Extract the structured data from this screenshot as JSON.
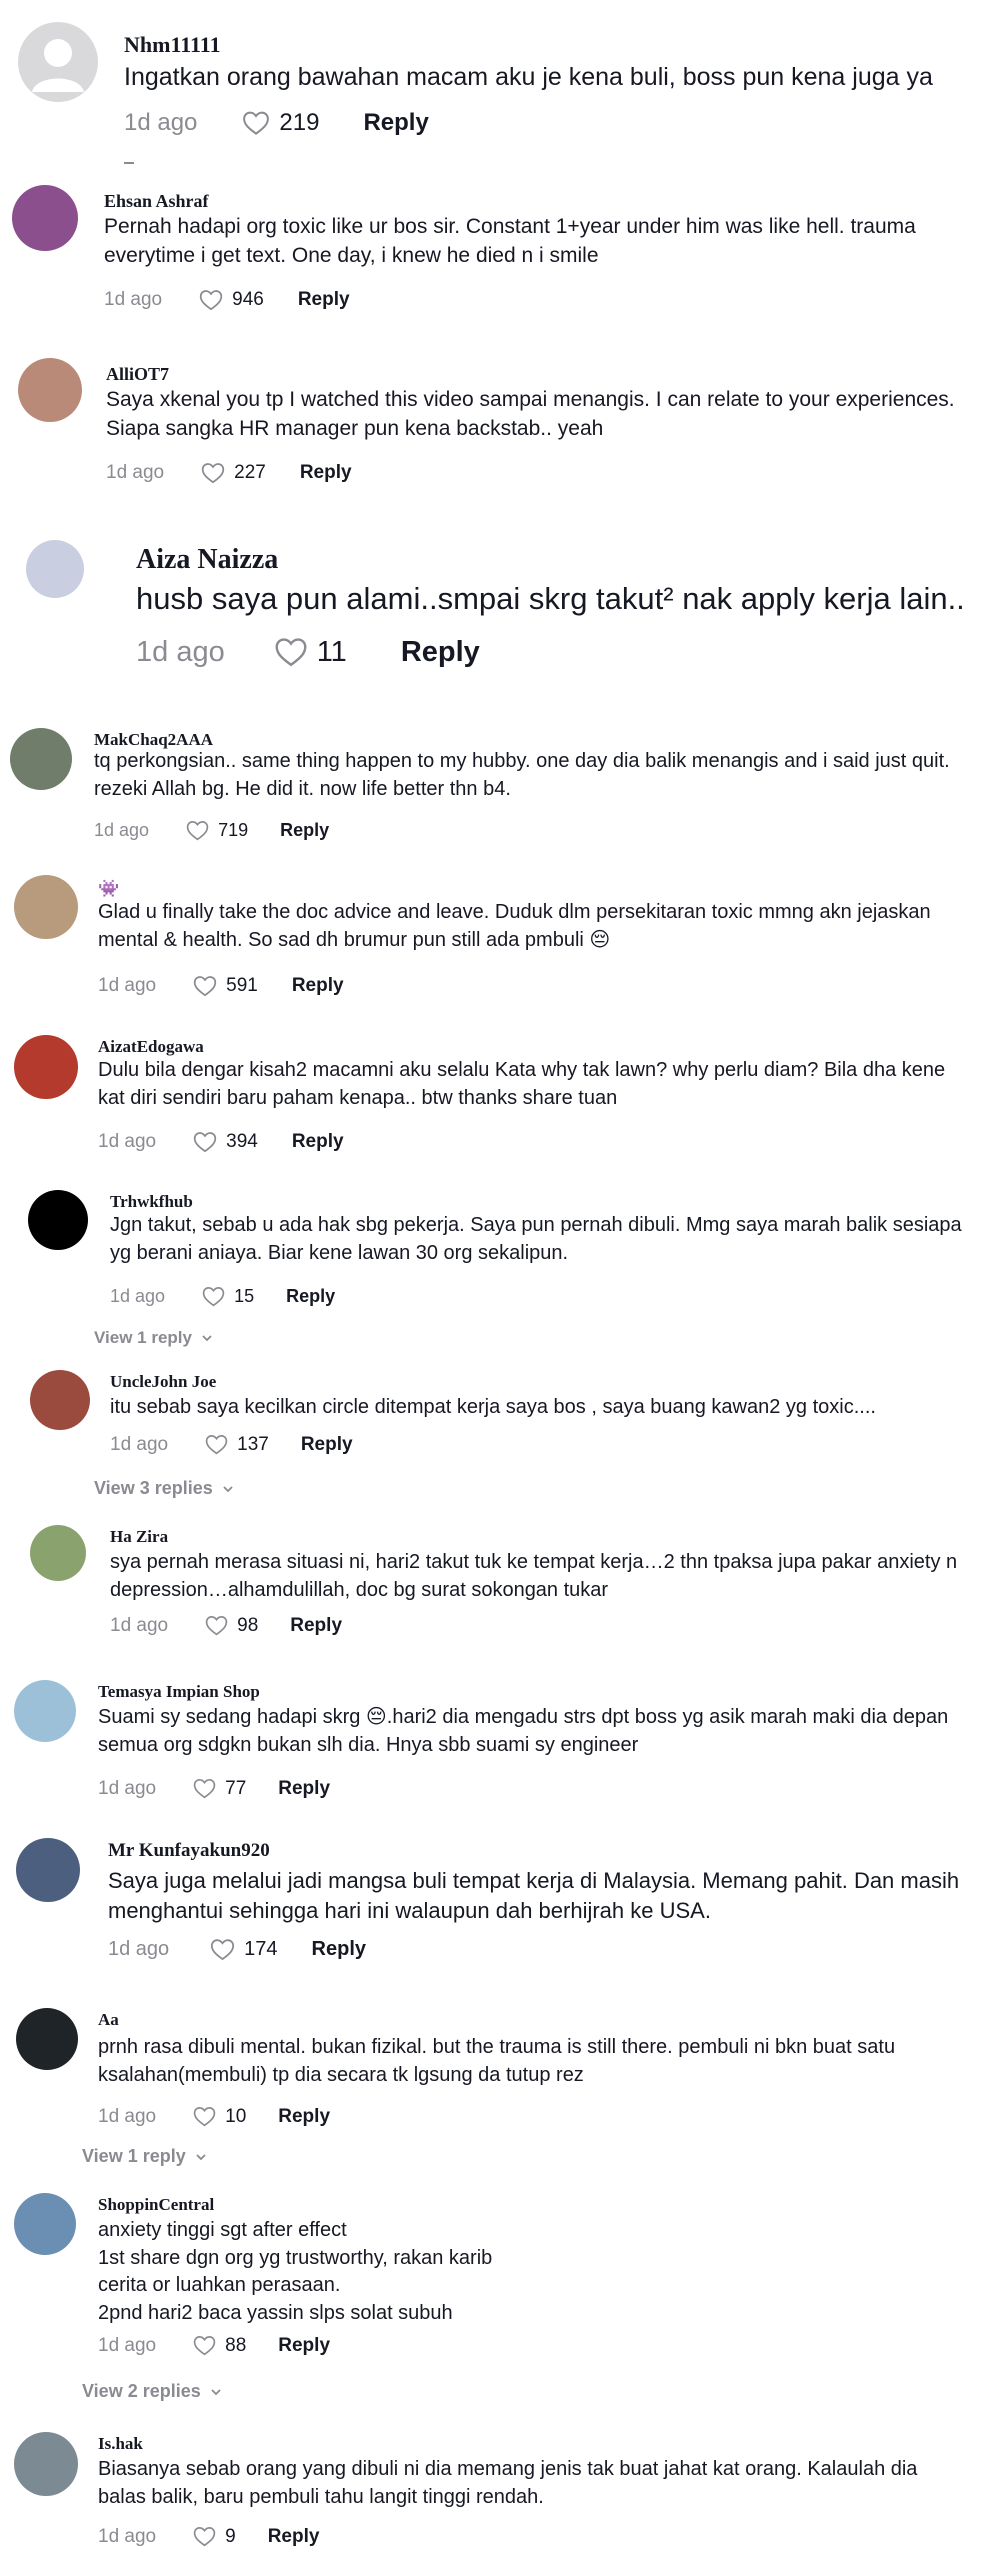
{
  "comments": [
    {
      "username": "Nhm11111",
      "text": "Ingatkan orang bawahan macam aku je kena buli, boss pun kena juga ya",
      "time": "1d ago",
      "likes": "219",
      "reply": "Reply",
      "avatar_color": "#d9d9dc"
    },
    {
      "username": "Ehsan Ashraf",
      "text": "Pernah hadapi org toxic like ur bos sir. Constant 1+year under him was like hell. trauma\neverytime i get text. One day, i knew he died n i smile",
      "time": "1d ago",
      "likes": "946",
      "reply": "Reply",
      "avatar_color": "#8a4f8c"
    },
    {
      "username": "AlliOT7",
      "text": "Saya xkenal you tp I watched this video sampai menangis. I can relate to your experiences.\nSiapa sangka HR manager pun kena backstab.. yeah",
      "time": "1d ago",
      "likes": "227",
      "reply": "Reply",
      "avatar_color": "#b98a78"
    },
    {
      "username": "Aiza Naizza",
      "text": "husb saya pun alami..smpai skrg takut² nak apply kerja lain..",
      "time": "1d ago",
      "likes": "11",
      "reply": "Reply",
      "avatar_color": "#c9cfe0"
    },
    {
      "username": "MakChaq2AAA",
      "text": "tq perkongsian.. same thing happen to my hubby. one day dia balik menangis and i said just quit.\nrezeki Allah bg. He did it. now life better thn b4.",
      "time": "1d ago",
      "likes": "719",
      "reply": "Reply",
      "avatar_color": "#6f7d6a"
    },
    {
      "username": "👾",
      "text": "Glad u finally take the doc advice and leave. Duduk dlm persekitaran toxic mmng akn jejaskan\nmental & health. So sad dh brumur pun still ada pmbuli 😔",
      "time": "1d ago",
      "likes": "591",
      "reply": "Reply",
      "avatar_color": "#b89a7d"
    },
    {
      "username": "AizatEdogawa",
      "text": "Dulu bila dengar kisah2 macamni aku selalu Kata why tak lawn? why perlu diam? Bila dha kene\nkat diri sendiri baru paham kenapa.. btw thanks share tuan",
      "time": "1d ago",
      "likes": "394",
      "reply": "Reply",
      "avatar_color": "#b33a2c"
    },
    {
      "username": "Trhwkfhub",
      "text": "Jgn takut, sebab u ada hak sbg pekerja. Saya pun pernah dibuli. Mmg saya marah balik sesiapa\nyg berani aniaya. Biar kene lawan 30 org sekalipun.",
      "time": "1d ago",
      "likes": "15",
      "reply": "Reply",
      "avatar_color": "#000000",
      "view_replies": "View 1 reply"
    },
    {
      "username": "UncleJohn Joe",
      "text": "itu sebab saya kecilkan circle ditempat kerja saya bos , saya buang kawan2 yg toxic....",
      "time": "1d ago",
      "likes": "137",
      "reply": "Reply",
      "avatar_color": "#9b4a3e",
      "view_replies": "View 3 replies"
    },
    {
      "username": "Ha Zira",
      "text": "sya pernah merasa situasi ni, hari2 takut tuk ke tempat kerja…2 thn tpaksa jupa pakar anxiety n\ndepression…alhamdulillah, doc bg surat sokongan tukar",
      "time": "1d ago",
      "likes": "98",
      "reply": "Reply",
      "avatar_color": "#8aa36e"
    },
    {
      "username": "Temasya Impian Shop",
      "text": "Suami sy sedang hadapi skrg 😔.hari2 dia mengadu strs dpt boss yg asik marah maki dia depan\nsemua org sdgkn bukan slh dia. Hnya sbb suami sy engineer",
      "time": "1d ago",
      "likes": "77",
      "reply": "Reply",
      "avatar_color": "#9cc0d8"
    },
    {
      "username": "Mr Kunfayakun920",
      "text": "Saya juga melalui jadi mangsa buli tempat kerja di Malaysia. Memang pahit. Dan masih\nmenghantui sehingga hari ini walaupun dah berhijrah ke USA.",
      "time": "1d ago",
      "likes": "174",
      "reply": "Reply",
      "avatar_color": "#4d5f7e"
    },
    {
      "username": "Aa",
      "text": "prnh rasa dibuli mental. bukan fizikal. but the trauma is still there. pembuli ni bkn buat satu\nksalahan(membuli) tp dia secara tk lgsung da tutup rez",
      "time": "1d ago",
      "likes": "10",
      "reply": "Reply",
      "avatar_color": "#1e2428",
      "view_replies": "View 1 reply"
    },
    {
      "username": "ShoppinCentral",
      "text": "anxiety tinggi sgt after effect\n1st share dgn org yg trustworthy, rakan karib\ncerita or luahkan perasaan.\n2pnd hari2 baca yassin slps solat subuh",
      "time": "1d ago",
      "likes": "88",
      "reply": "Reply",
      "avatar_color": "#6a8fb3",
      "view_replies": "View 2 replies"
    },
    {
      "username": "Is.hak",
      "text": "Biasanya sebab orang yang dibuli ni dia memang jenis tak buat jahat kat orang. Kalaulah dia\nbalas balik, baru pembuli tahu langit tinggi rendah.",
      "time": "1d ago",
      "likes": "9",
      "reply": "Reply",
      "avatar_color": "#7c8a93"
    }
  ]
}
